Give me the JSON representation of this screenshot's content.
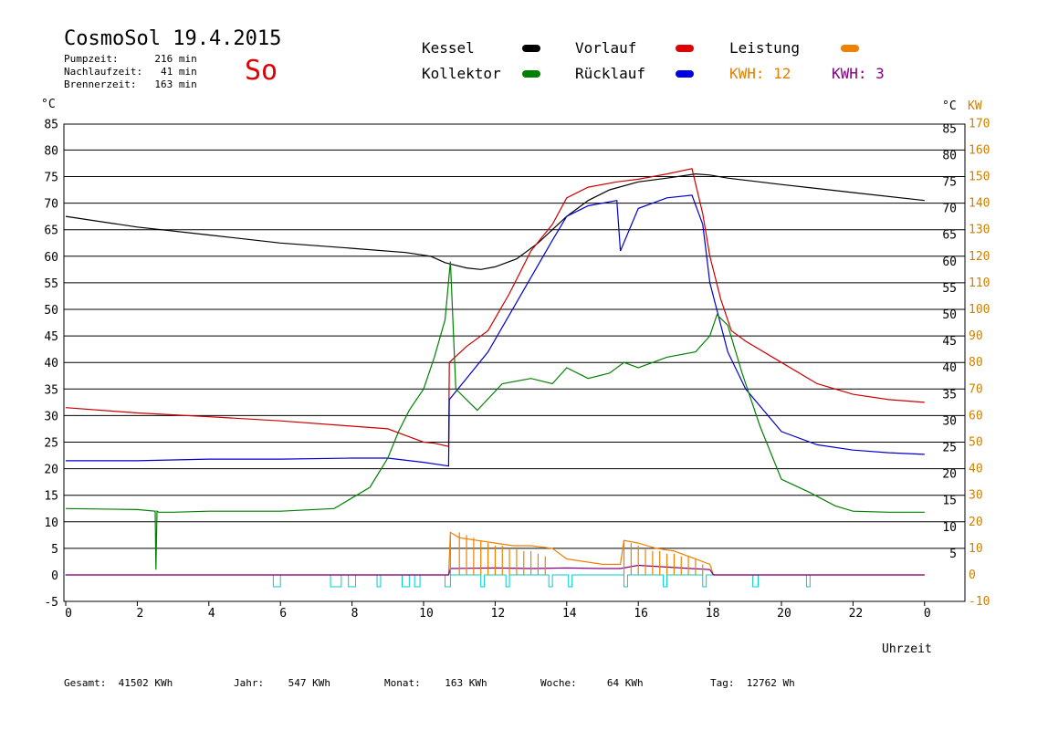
{
  "header": {
    "title": "CosmoSol 19.4.2015",
    "pump_line": "Pumpzeit:      216 min",
    "nachlauf_line": "Nachlaufzeit:   41 min",
    "brenner_line": "Brennerzeit:   163 min",
    "day": "So"
  },
  "legend": {
    "kessel": "Kessel",
    "kollektor": "Kollektor",
    "vorlauf": "Vorlauf",
    "ruecklauf": "Rücklauf",
    "leistung": "Leistung",
    "kwh_orange": "KWH: 12",
    "kwh_purple": "KWH: 3"
  },
  "colors": {
    "kessel": "#000000",
    "kollektor": "#008000",
    "vorlauf": "#cc0000",
    "ruecklauf": "#0000cc",
    "leistung": "#f08000",
    "kwh_purple": "#800080",
    "pump": "#00cccc",
    "axis_right": "#d08000"
  },
  "footer": {
    "gesamt": "Gesamt:  41502 KWh",
    "jahr": "Jahr:    547 KWh",
    "monat": "Monat:    163 KWh",
    "woche": "Woche:     64 KWh",
    "tag": "Tag:  12762 Wh"
  },
  "chart_data": {
    "type": "line",
    "xlabel": "Uhrzeit",
    "ylabel_left": "°C",
    "ylabel_right_c": "°C",
    "ylabel_right_kw": "KW",
    "xlim": [
      0,
      24
    ],
    "ylim": [
      -5,
      85
    ],
    "ylim_kw": [
      -10,
      170
    ],
    "x_ticks": [
      "0",
      "2",
      "4",
      "6",
      "8",
      "10",
      "12",
      "14",
      "16",
      "18",
      "20",
      "22",
      "0"
    ],
    "y_ticks": [
      -5,
      0,
      5,
      10,
      15,
      20,
      25,
      30,
      35,
      40,
      45,
      50,
      55,
      60,
      65,
      70,
      75,
      80,
      85
    ],
    "y_ticks_right_c": [
      5,
      10,
      15,
      20,
      25,
      30,
      35,
      40,
      45,
      50,
      55,
      60,
      65,
      70,
      75,
      80,
      85
    ],
    "y_ticks_kw": [
      -10,
      0,
      10,
      20,
      30,
      40,
      50,
      60,
      70,
      80,
      90,
      100,
      110,
      120,
      130,
      140,
      150,
      160,
      170
    ],
    "grid": true,
    "series": [
      {
        "name": "Kessel",
        "key": "kessel",
        "x": [
          0,
          2,
          4,
          6,
          8,
          9.5,
          10.2,
          10.6,
          11.2,
          11.6,
          12,
          12.6,
          13.2,
          14,
          14.6,
          15.2,
          16,
          16.8,
          17.6,
          18,
          18.5,
          20,
          22,
          24
        ],
        "y": [
          67.5,
          65.5,
          64,
          62.5,
          61.5,
          60.7,
          60,
          58.8,
          57.8,
          57.5,
          58,
          59.5,
          62.5,
          67.5,
          70.5,
          72.5,
          74,
          74.7,
          75.5,
          75.3,
          74.7,
          73.5,
          72,
          70.5
        ]
      },
      {
        "name": "Vorlauf",
        "key": "vorlauf",
        "x": [
          0,
          2,
          4,
          6,
          8,
          9,
          9.6,
          10,
          10.3,
          10.7,
          10.72,
          11.2,
          11.8,
          12.4,
          13,
          13.6,
          14,
          14.6,
          15.4,
          16,
          16.8,
          17.5,
          17.8,
          18,
          18.3,
          18.6,
          19,
          20,
          21,
          22,
          23,
          24
        ],
        "y": [
          31.5,
          30.5,
          29.8,
          29,
          28,
          27.5,
          26,
          25,
          24.8,
          24.2,
          40,
          43,
          46,
          53,
          61,
          66,
          71,
          73,
          74,
          74.5,
          75.5,
          76.5,
          68,
          60,
          52,
          46,
          44,
          40,
          36,
          34,
          33,
          32.5
        ]
      },
      {
        "name": "Rücklauf",
        "key": "ruecklauf",
        "x": [
          0,
          2,
          4,
          6,
          8,
          9,
          10,
          10.7,
          10.72,
          11.2,
          11.8,
          12.4,
          13,
          13.6,
          14,
          14.6,
          15.4,
          15.5,
          16,
          16.8,
          17.5,
          17.8,
          18,
          18.5,
          19,
          20,
          21,
          22,
          23,
          24
        ],
        "y": [
          21.5,
          21.5,
          21.8,
          21.8,
          22,
          22,
          21.2,
          20.5,
          33,
          37,
          42,
          49,
          56,
          63,
          67.5,
          69.5,
          70.5,
          61,
          69,
          71,
          71.5,
          66,
          55,
          42,
          35,
          27,
          24.5,
          23.5,
          23,
          22.7
        ]
      },
      {
        "name": "Kollektor",
        "key": "kollektor",
        "x": [
          0,
          2,
          2.5,
          2.52,
          2.55,
          2.6,
          3,
          4,
          6,
          7.5,
          8.5,
          9,
          9.3,
          9.6,
          10,
          10.3,
          10.6,
          10.75,
          10.9,
          11.5,
          12.2,
          13,
          13.6,
          14,
          14.6,
          15.2,
          15.6,
          16,
          16.8,
          17.6,
          18,
          18.2,
          18.5,
          18.9,
          19.4,
          20,
          20.8,
          21.5,
          22,
          23,
          24
        ],
        "y": [
          12.5,
          12.3,
          12,
          1,
          12,
          11.8,
          11.8,
          12,
          12,
          12.5,
          16.5,
          22,
          27,
          31,
          35,
          41,
          48,
          59,
          35,
          31,
          36,
          37,
          36,
          39,
          37,
          38,
          40,
          39,
          41,
          42,
          45,
          49,
          47,
          38,
          28,
          18,
          15.5,
          13,
          12,
          11.8,
          11.8
        ]
      },
      {
        "name": "Leistung",
        "key": "leistung",
        "x": [
          0,
          10.7,
          10.75,
          11,
          11.5,
          12,
          12.5,
          13,
          13.6,
          14,
          15,
          15.5,
          15.6,
          16,
          16.5,
          17,
          17.6,
          18,
          18.1,
          24
        ],
        "y": [
          0,
          0,
          8,
          7,
          6.5,
          6,
          5.5,
          5.5,
          5,
          3,
          2,
          2,
          6.5,
          6,
          5,
          4.5,
          3,
          2,
          0,
          0
        ]
      },
      {
        "name": "KWH Purple",
        "key": "kwh_purple",
        "x": [
          0,
          10.7,
          10.75,
          12,
          13,
          14,
          15,
          15.5,
          16,
          17,
          18,
          18.1,
          24
        ],
        "y": [
          0,
          0,
          1.2,
          1.3,
          1.2,
          1.3,
          1.2,
          1.2,
          1.8,
          1.4,
          1,
          0,
          0
        ]
      }
    ],
    "pump_pulses": [
      [
        5.8,
        6.0
      ],
      [
        7.4,
        7.7
      ],
      [
        7.9,
        8.1
      ],
      [
        8.7,
        8.8
      ],
      [
        9.4,
        9.6
      ],
      [
        9.75,
        9.9
      ],
      [
        10.6,
        10.75
      ],
      [
        11.6,
        11.7
      ],
      [
        12.3,
        12.4
      ],
      [
        13.5,
        13.6
      ],
      [
        14.05,
        14.15
      ],
      [
        15.6,
        15.7
      ],
      [
        16.7,
        16.8
      ],
      [
        17.8,
        17.9
      ],
      [
        19.2,
        19.35
      ],
      [
        20.7,
        20.8
      ]
    ],
    "power_spikes": {
      "x": [
        10.75,
        11.0,
        11.2,
        11.4,
        11.6,
        11.8,
        12.0,
        12.2,
        12.4,
        12.6,
        12.8,
        13.0,
        13.2,
        13.4,
        15.6,
        15.8,
        16.0,
        16.2,
        16.4,
        16.6,
        16.8,
        17.0,
        17.2,
        17.4,
        17.6,
        17.8
      ],
      "y": [
        7.5,
        8,
        7.5,
        7,
        6.5,
        6,
        5.5,
        5.5,
        5,
        5,
        4.5,
        4.5,
        4,
        3.5,
        6.5,
        6,
        5.5,
        5,
        4.5,
        4.5,
        4,
        4,
        3.5,
        3.5,
        3,
        2
      ]
    }
  }
}
